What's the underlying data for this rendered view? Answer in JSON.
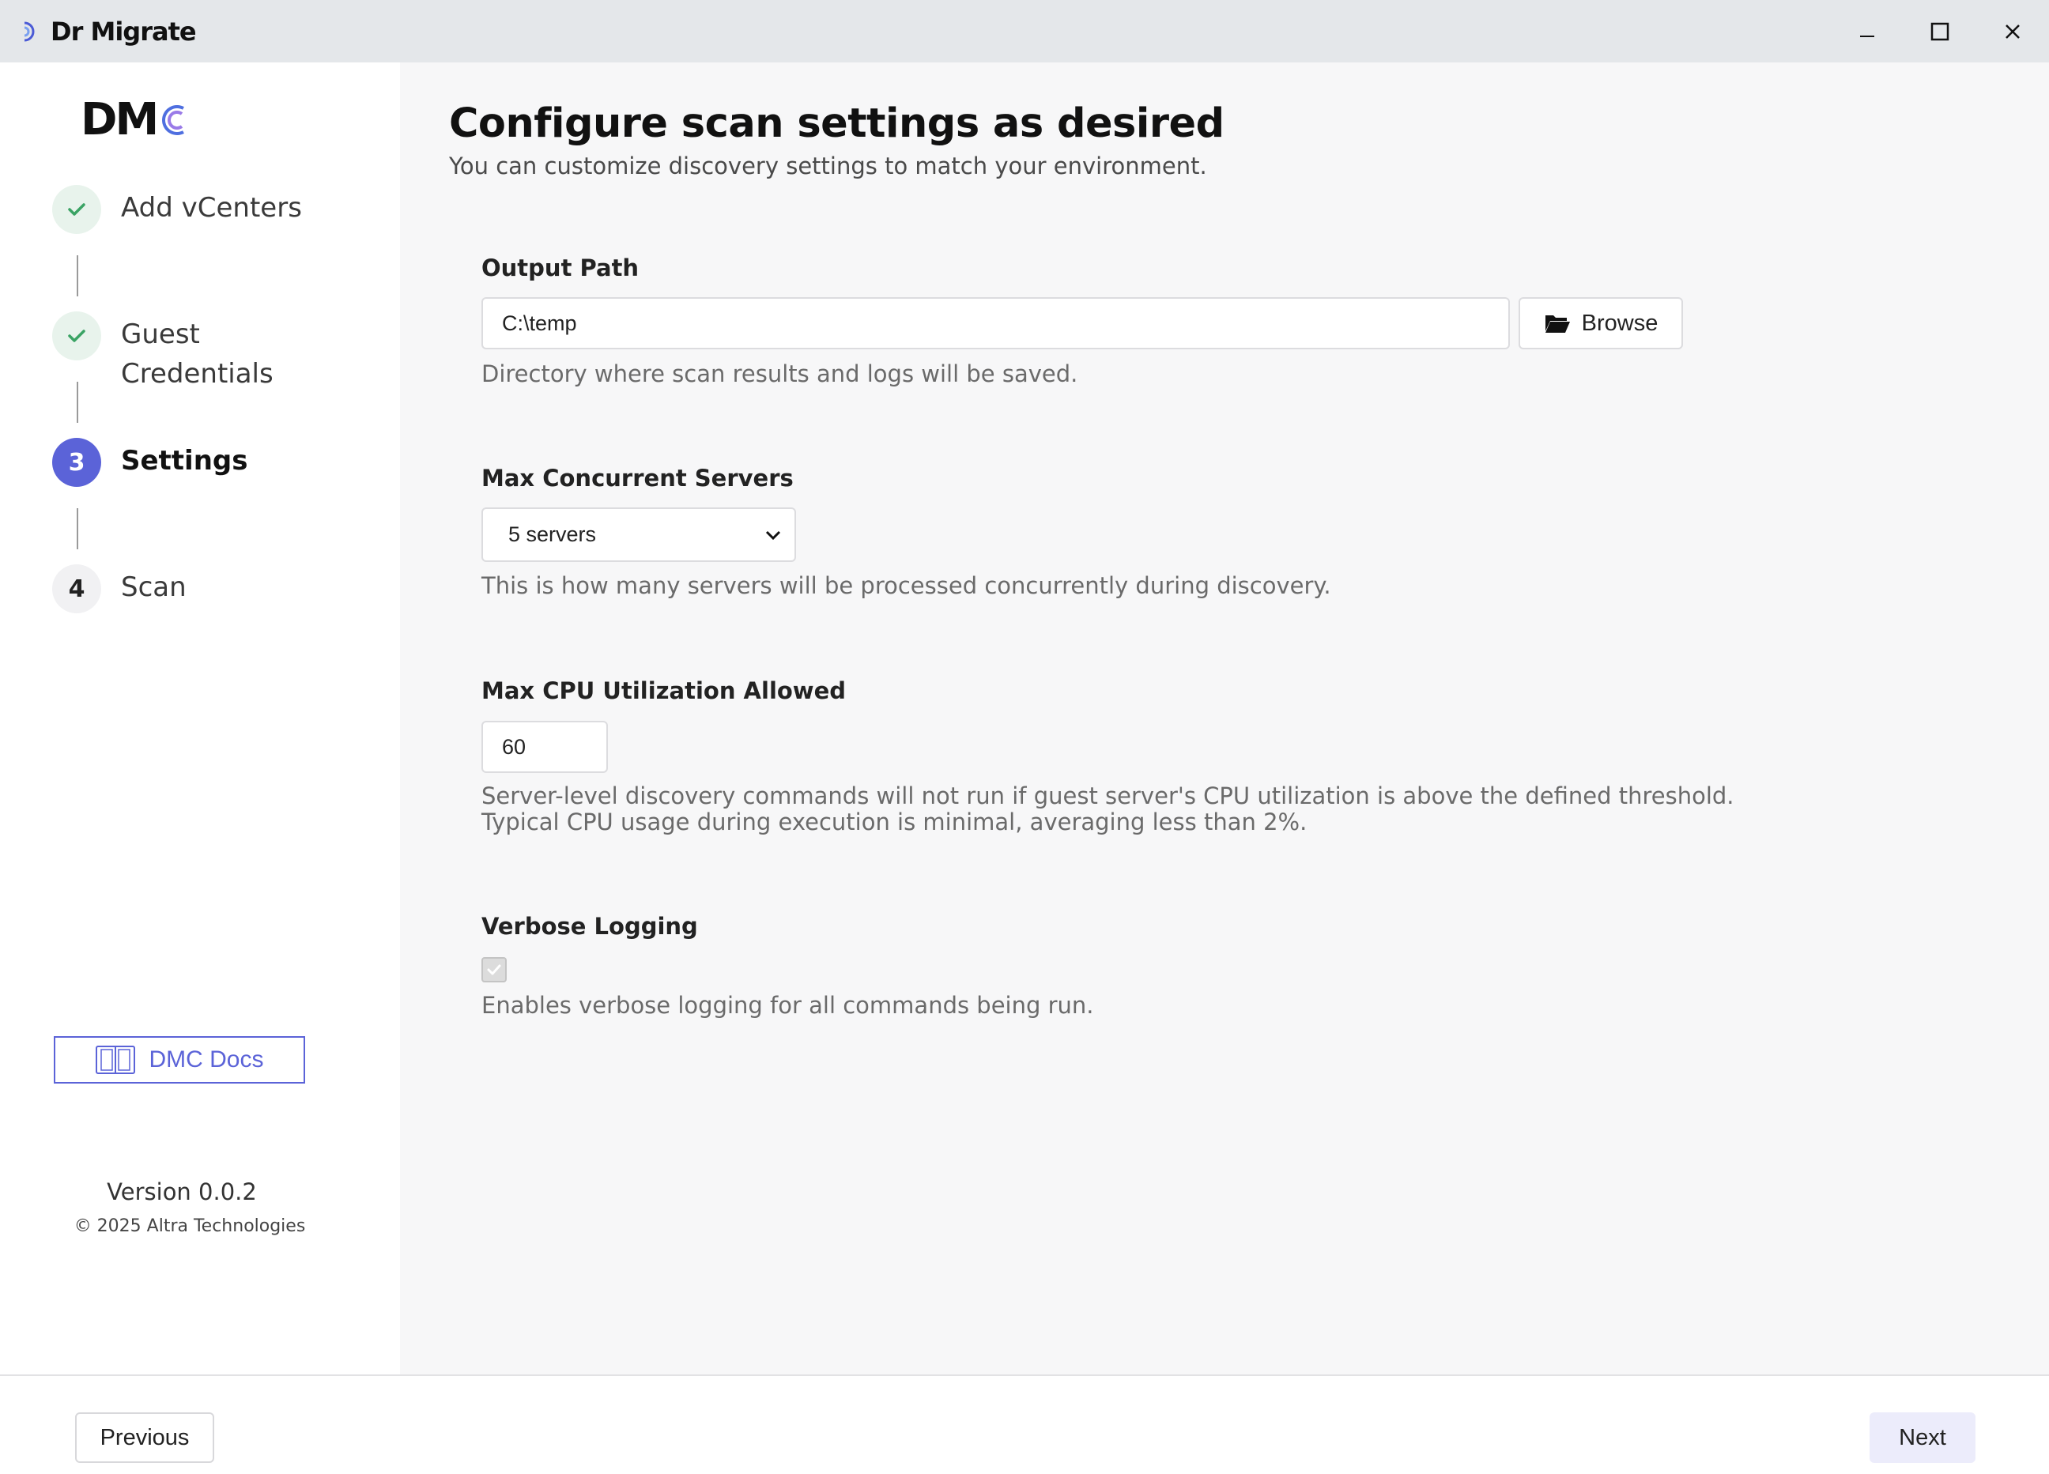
{
  "window": {
    "title": "Dr Migrate",
    "controls": [
      "minimize-icon",
      "maximize-icon",
      "close-icon"
    ]
  },
  "sidebar": {
    "logo_text": "DM",
    "steps": [
      {
        "number": "1",
        "label": "Add vCenters",
        "state": "done"
      },
      {
        "number": "2",
        "label": "Guest Credentials",
        "state": "done"
      },
      {
        "number": "3",
        "label": "Settings",
        "state": "active"
      },
      {
        "number": "4",
        "label": "Scan",
        "state": "pending"
      }
    ],
    "docs_label": "DMC Docs",
    "version": "Version 0.0.2",
    "copyright": "© 2025 Altra Technologies"
  },
  "main": {
    "title": "Configure scan settings as desired",
    "subtitle": "You can customize discovery settings to match your environment.",
    "output_path": {
      "label": "Output Path",
      "value": "C:\\temp",
      "browse_label": "Browse",
      "help": "Directory where scan results and logs will be saved."
    },
    "max_concurrent": {
      "label": "Max Concurrent Servers",
      "selected": "5 servers",
      "help": "This is how many servers will be processed concurrently during discovery."
    },
    "max_cpu": {
      "label": "Max CPU Utilization Allowed",
      "value": "60",
      "help_line1": "Server-level discovery commands will not run if guest server's CPU utilization is above the defined threshold.",
      "help_line2": "Typical CPU usage during execution is minimal, averaging less than 2%."
    },
    "verbose": {
      "label": "Verbose Logging",
      "checked": true,
      "disabled": true,
      "help": "Enables verbose logging for all commands being run."
    }
  },
  "footer": {
    "previous_label": "Previous",
    "next_label": "Next"
  },
  "colors": {
    "accent": "#5b63d8",
    "success": "#3aa364",
    "titlebar": "#e4e7ea",
    "next_bg": "#ececfb"
  }
}
